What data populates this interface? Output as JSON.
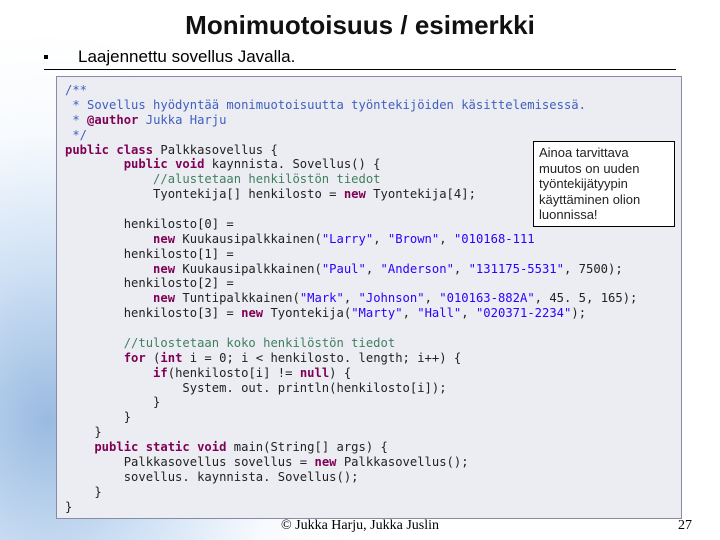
{
  "title": "Monimuotoisuus / esimerkki",
  "bullet": "Laajennettu sovellus Javalla.",
  "callout": "Ainoa tarvittava muutos on uuden työntekijätyypin käyttäminen olion luonnissa!",
  "footer": "© Jukka Harju, Jukka Juslin",
  "page": "27",
  "code": {
    "l1": "/**",
    "l2": " * Sovellus hyödyntää monimuotoisuutta työntekijöiden käsittelemisessä.",
    "l3a": " * ",
    "l3tag": "@author",
    "l3b": " Jukka Harju",
    "l4": " */",
    "l5a": "public",
    "l5b": " class",
    "l5c": " Palkkasovellus {",
    "l6a": "        public",
    "l6b": " void",
    "l6c": " kaynnista. Sovellus() {",
    "l7": "            //alustetaan henkilöstön tiedot",
    "l8a": "            Tyontekija[] henkilosto = ",
    "l8b": "new",
    "l8c": " Tyontekija[4];",
    "l10a": "        henkilosto[0] =",
    "l11a": "            new",
    "l11b": " Kuukausipalkkainen(",
    "l11c": "\"Larry\"",
    "l11d": ", ",
    "l11e": "\"Brown\"",
    "l11f": ", ",
    "l11g": "\"010168-111",
    "l11h": "",
    "l12a": "        henkilosto[1] =",
    "l13a": "            new",
    "l13b": " Kuukausipalkkainen(",
    "l13c": "\"Paul\"",
    "l13d": ", ",
    "l13e": "\"Anderson\"",
    "l13f": ", ",
    "l13g": "\"131175-5531\"",
    "l13h": ", 7500);",
    "l14a": "        henkilosto[2] =",
    "l15a": "            new",
    "l15b": " Tuntipalkkainen(",
    "l15c": "\"Mark\"",
    "l15d": ", ",
    "l15e": "\"Johnson\"",
    "l15f": ", ",
    "l15g": "\"010163-882A\"",
    "l15h": ", 45. 5, 165);",
    "l16a": "        henkilosto[3] = ",
    "l16b": "new",
    "l16c": " Tyontekija(",
    "l16d": "\"Marty\"",
    "l16e": ", ",
    "l16f": "\"Hall\"",
    "l16g": ", ",
    "l16h": "\"020371-2234\"",
    "l16i": ");",
    "l18": "        //tulostetaan koko henkilöstön tiedot",
    "l19a": "        for",
    "l19b": " (",
    "l19c": "int",
    "l19d": " i = 0; i < henkilosto. length; i++) {",
    "l20a": "            if",
    "l20b": "(henkilosto[i] != ",
    "l20c": "null",
    "l20d": ") {",
    "l21": "                System. out. println(henkilosto[i]);",
    "l22": "            }",
    "l23": "        }",
    "l24": "    }",
    "l25a": "    public",
    "l25b": " static",
    "l25c": " void",
    "l25d": " main(String[] args) {",
    "l26a": "        Palkkasovellus sovellus = ",
    "l26b": "new",
    "l26c": " Palkkasovellus();",
    "l27": "        sovellus. kaynnista. Sovellus();",
    "l28": "    }",
    "l29": "}"
  }
}
